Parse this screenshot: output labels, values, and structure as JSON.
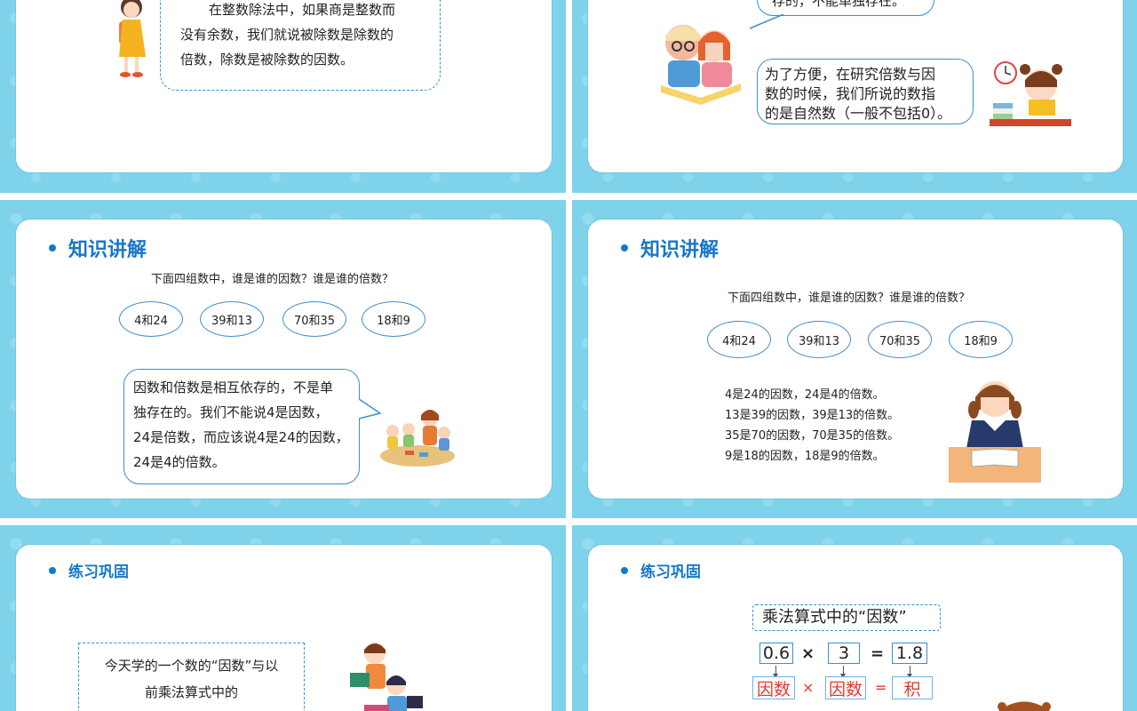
{
  "slides": {
    "s1": {
      "quote": "在整数除法中，如果商是整数而没有余数，我们就说被除数是除数的倍数，除数是被除数的因数。",
      "line1": "在整数除法中，如果商是整数而",
      "line2": "没有余数，我们就说被除数是除数的",
      "line3": "倍数，除数是被除数的因数。"
    },
    "s2": {
      "top_text": "存的，不能单独存在。",
      "line1": "为了方便，在研究倍数与因",
      "line2": "数的时候，我们所说的数指",
      "line3": "的是自然数（一般不包括0）。"
    },
    "s3": {
      "heading": "知识讲解",
      "question": "下面四组数中，谁是谁的因数？谁是谁的倍数？",
      "pairs": [
        "4和24",
        "39和13",
        "70和35",
        "18和9"
      ],
      "l1": "因数和倍数是相互依存的，不是单",
      "l2": "独存在的。我们不能说4是因数，",
      "l3": "24是倍数，而应该说4是24的因数，",
      "l4": "24是4的倍数。"
    },
    "s4": {
      "heading": "知识讲解",
      "question": "下面四组数中，谁是谁的因数？谁是谁的倍数？",
      "pairs": [
        "4和24",
        "39和13",
        "70和35",
        "18和9"
      ],
      "facts": [
        "4是24的因数，24是4的倍数。",
        "13是39的因数，39是13的倍数。",
        "35是70的因数，70是35的倍数。",
        "9是18的因数，18是9的倍数。"
      ]
    },
    "s5": {
      "heading": "练习巩固",
      "l1": "今天学的一个数的“因数”与以",
      "l2": "前乘法算式中的"
    },
    "s6": {
      "heading": "练习巩固",
      "title": "乘法算式中的“因数”",
      "n1": "0.6",
      "times": "×",
      "n2": "3",
      "eq": "=",
      "n3": "1.8",
      "r1": "因数",
      "r2": "因数",
      "r3": "积"
    }
  },
  "colors": {
    "background_tile": "#7ed3ea",
    "heading": "#1877c9",
    "border": "#3a8fd0",
    "red_text": "#e23a2e"
  }
}
